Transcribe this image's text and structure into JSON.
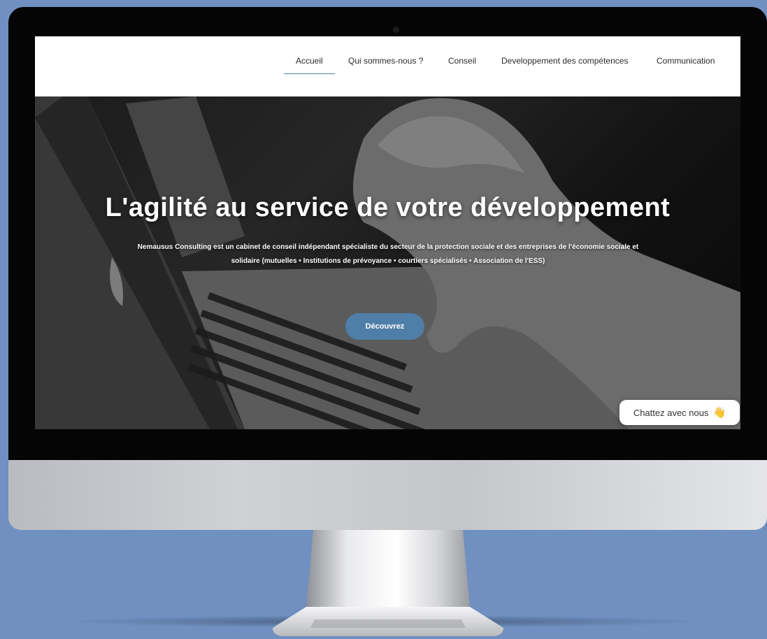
{
  "nav": {
    "items": [
      {
        "label": "Accueil",
        "active": true
      },
      {
        "label": "Qui sommes-nous ?",
        "active": false
      },
      {
        "label": "Conseil",
        "active": false
      },
      {
        "label": "Developpement des compétences",
        "active": false
      },
      {
        "label": "Communication",
        "active": false
      }
    ]
  },
  "hero": {
    "title": "L'agilité au service de votre développement",
    "description_line1": "Nemausus Consulting est un cabinet de conseil indépendant spécialiste du secteur de la protection sociale et des entreprises de l'économie sociale et",
    "description_line2": "solidaire (mutuelles • Institutions de prévoyance • courtiers spécialisés • Association de l'ESS)",
    "cta_label": "Découvrez"
  },
  "chat": {
    "label": "Chattez avec nous",
    "icon": "waving-hand-icon"
  },
  "colors": {
    "background": "#6f90c0",
    "accent": "#4f7fa8"
  }
}
